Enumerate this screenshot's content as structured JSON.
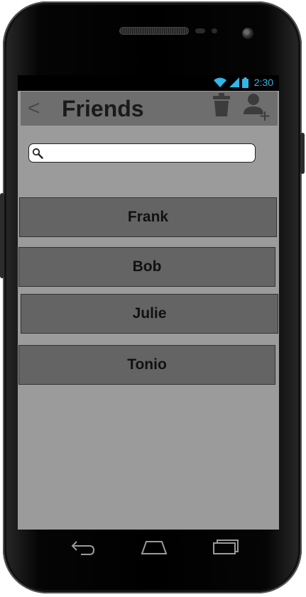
{
  "status_bar": {
    "time": "2:30",
    "icons": [
      "wifi-icon",
      "signal-icon",
      "battery-icon"
    ]
  },
  "action_bar": {
    "back_label": "<",
    "title": "Friends",
    "icons": [
      "trash-icon",
      "add-user-icon"
    ]
  },
  "search": {
    "value": "",
    "placeholder": "",
    "icon": "search-icon"
  },
  "friends": [
    {
      "name": "Frank"
    },
    {
      "name": "Bob"
    },
    {
      "name": "Julie"
    },
    {
      "name": "Tonio"
    }
  ],
  "nav_bar": {
    "icons": [
      "back-nav-icon",
      "home-nav-icon",
      "recent-apps-icon"
    ]
  },
  "colors": {
    "status_accent": "#33b5e5",
    "action_bar": "#6e6e6e",
    "content_bg": "#9b9b9b",
    "list_item": "#646464"
  }
}
